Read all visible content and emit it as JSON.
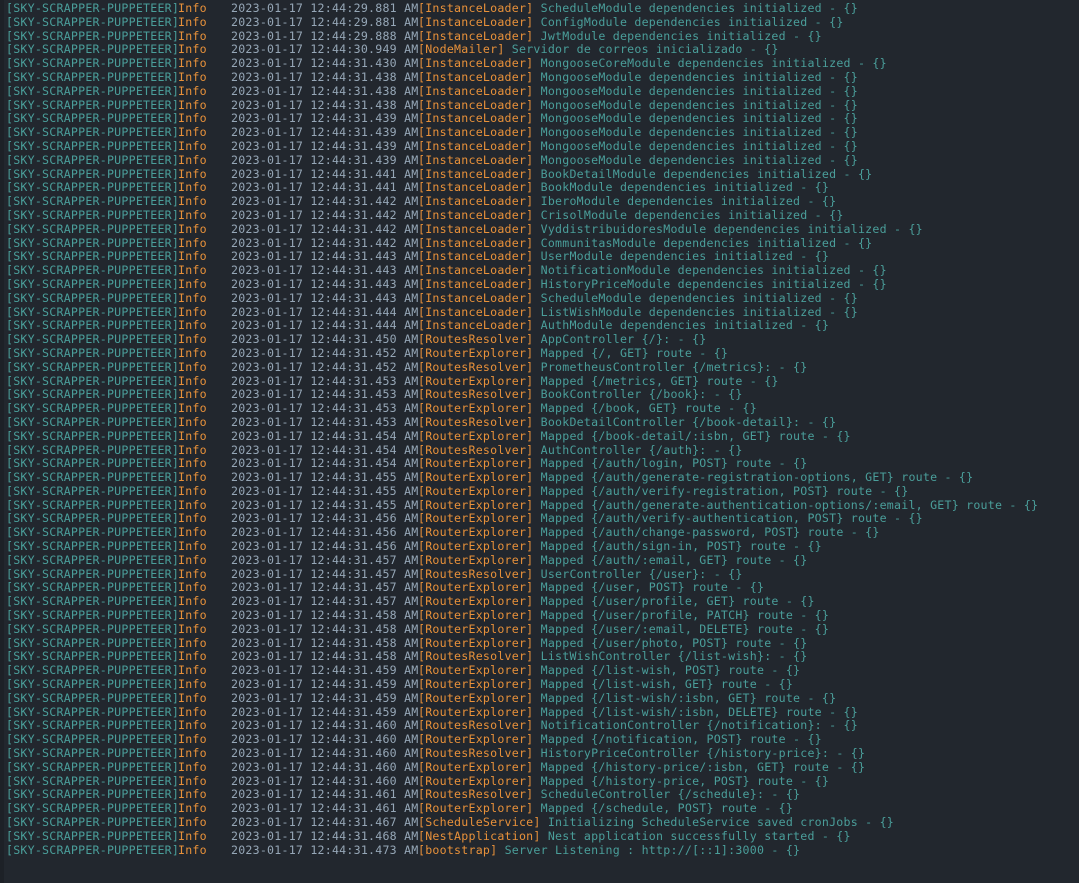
{
  "terminal": {
    "background_color": "#22272e",
    "prefix_color": "#4a9e9a",
    "level_color": "#e8913a",
    "timestamp_color": "#96a7b7",
    "context_color": "#e8913a",
    "message_color": "#4a9e9a",
    "app_prefix": "[SKY-SCRAPPER-PUPPETEER]",
    "level": "Info",
    "date": "2023-01-17",
    "meridiem": "AM",
    "line_count": 63
  },
  "lines": [
    {
      "prefix": "[SKY-SCRAPPER-PUPPETEER]",
      "level": "Info",
      "time": "2023-01-17 12:44:29.881 AM",
      "context": "[InstanceLoader]",
      "message": "ScheduleModule dependencies initialized - {}"
    },
    {
      "prefix": "[SKY-SCRAPPER-PUPPETEER]",
      "level": "Info",
      "time": "2023-01-17 12:44:29.881 AM",
      "context": "[InstanceLoader]",
      "message": "ConfigModule dependencies initialized - {}"
    },
    {
      "prefix": "[SKY-SCRAPPER-PUPPETEER]",
      "level": "Info",
      "time": "2023-01-17 12:44:29.888 AM",
      "context": "[InstanceLoader]",
      "message": "JwtModule dependencies initialized - {}"
    },
    {
      "prefix": "[SKY-SCRAPPER-PUPPETEER]",
      "level": "Info",
      "time": "2023-01-17 12:44:30.949 AM",
      "context": "[NodeMailer]",
      "message": "Servidor de correos inicializado - {}"
    },
    {
      "prefix": "[SKY-SCRAPPER-PUPPETEER]",
      "level": "Info",
      "time": "2023-01-17 12:44:31.430 AM",
      "context": "[InstanceLoader]",
      "message": "MongooseCoreModule dependencies initialized - {}"
    },
    {
      "prefix": "[SKY-SCRAPPER-PUPPETEER]",
      "level": "Info",
      "time": "2023-01-17 12:44:31.438 AM",
      "context": "[InstanceLoader]",
      "message": "MongooseModule dependencies initialized - {}"
    },
    {
      "prefix": "[SKY-SCRAPPER-PUPPETEER]",
      "level": "Info",
      "time": "2023-01-17 12:44:31.438 AM",
      "context": "[InstanceLoader]",
      "message": "MongooseModule dependencies initialized - {}"
    },
    {
      "prefix": "[SKY-SCRAPPER-PUPPETEER]",
      "level": "Info",
      "time": "2023-01-17 12:44:31.438 AM",
      "context": "[InstanceLoader]",
      "message": "MongooseModule dependencies initialized - {}"
    },
    {
      "prefix": "[SKY-SCRAPPER-PUPPETEER]",
      "level": "Info",
      "time": "2023-01-17 12:44:31.439 AM",
      "context": "[InstanceLoader]",
      "message": "MongooseModule dependencies initialized - {}"
    },
    {
      "prefix": "[SKY-SCRAPPER-PUPPETEER]",
      "level": "Info",
      "time": "2023-01-17 12:44:31.439 AM",
      "context": "[InstanceLoader]",
      "message": "MongooseModule dependencies initialized - {}"
    },
    {
      "prefix": "[SKY-SCRAPPER-PUPPETEER]",
      "level": "Info",
      "time": "2023-01-17 12:44:31.439 AM",
      "context": "[InstanceLoader]",
      "message": "MongooseModule dependencies initialized - {}"
    },
    {
      "prefix": "[SKY-SCRAPPER-PUPPETEER]",
      "level": "Info",
      "time": "2023-01-17 12:44:31.439 AM",
      "context": "[InstanceLoader]",
      "message": "MongooseModule dependencies initialized - {}"
    },
    {
      "prefix": "[SKY-SCRAPPER-PUPPETEER]",
      "level": "Info",
      "time": "2023-01-17 12:44:31.441 AM",
      "context": "[InstanceLoader]",
      "message": "BookDetailModule dependencies initialized - {}"
    },
    {
      "prefix": "[SKY-SCRAPPER-PUPPETEER]",
      "level": "Info",
      "time": "2023-01-17 12:44:31.441 AM",
      "context": "[InstanceLoader]",
      "message": "BookModule dependencies initialized - {}"
    },
    {
      "prefix": "[SKY-SCRAPPER-PUPPETEER]",
      "level": "Info",
      "time": "2023-01-17 12:44:31.442 AM",
      "context": "[InstanceLoader]",
      "message": "IberoModule dependencies initialized - {}"
    },
    {
      "prefix": "[SKY-SCRAPPER-PUPPETEER]",
      "level": "Info",
      "time": "2023-01-17 12:44:31.442 AM",
      "context": "[InstanceLoader]",
      "message": "CrisolModule dependencies initialized - {}"
    },
    {
      "prefix": "[SKY-SCRAPPER-PUPPETEER]",
      "level": "Info",
      "time": "2023-01-17 12:44:31.442 AM",
      "context": "[InstanceLoader]",
      "message": "VyddistribuidoresModule dependencies initialized - {}"
    },
    {
      "prefix": "[SKY-SCRAPPER-PUPPETEER]",
      "level": "Info",
      "time": "2023-01-17 12:44:31.442 AM",
      "context": "[InstanceLoader]",
      "message": "CommunitasModule dependencies initialized - {}"
    },
    {
      "prefix": "[SKY-SCRAPPER-PUPPETEER]",
      "level": "Info",
      "time": "2023-01-17 12:44:31.443 AM",
      "context": "[InstanceLoader]",
      "message": "UserModule dependencies initialized - {}"
    },
    {
      "prefix": "[SKY-SCRAPPER-PUPPETEER]",
      "level": "Info",
      "time": "2023-01-17 12:44:31.443 AM",
      "context": "[InstanceLoader]",
      "message": "NotificationModule dependencies initialized - {}"
    },
    {
      "prefix": "[SKY-SCRAPPER-PUPPETEER]",
      "level": "Info",
      "time": "2023-01-17 12:44:31.443 AM",
      "context": "[InstanceLoader]",
      "message": "HistoryPriceModule dependencies initialized - {}"
    },
    {
      "prefix": "[SKY-SCRAPPER-PUPPETEER]",
      "level": "Info",
      "time": "2023-01-17 12:44:31.443 AM",
      "context": "[InstanceLoader]",
      "message": "ScheduleModule dependencies initialized - {}"
    },
    {
      "prefix": "[SKY-SCRAPPER-PUPPETEER]",
      "level": "Info",
      "time": "2023-01-17 12:44:31.444 AM",
      "context": "[InstanceLoader]",
      "message": "ListWishModule dependencies initialized - {}"
    },
    {
      "prefix": "[SKY-SCRAPPER-PUPPETEER]",
      "level": "Info",
      "time": "2023-01-17 12:44:31.444 AM",
      "context": "[InstanceLoader]",
      "message": "AuthModule dependencies initialized - {}"
    },
    {
      "prefix": "[SKY-SCRAPPER-PUPPETEER]",
      "level": "Info",
      "time": "2023-01-17 12:44:31.450 AM",
      "context": "[RoutesResolver]",
      "message": "AppController {/}: - {}"
    },
    {
      "prefix": "[SKY-SCRAPPER-PUPPETEER]",
      "level": "Info",
      "time": "2023-01-17 12:44:31.452 AM",
      "context": "[RouterExplorer]",
      "message": "Mapped {/, GET} route - {}"
    },
    {
      "prefix": "[SKY-SCRAPPER-PUPPETEER]",
      "level": "Info",
      "time": "2023-01-17 12:44:31.452 AM",
      "context": "[RoutesResolver]",
      "message": "PrometheusController {/metrics}: - {}"
    },
    {
      "prefix": "[SKY-SCRAPPER-PUPPETEER]",
      "level": "Info",
      "time": "2023-01-17 12:44:31.453 AM",
      "context": "[RouterExplorer]",
      "message": "Mapped {/metrics, GET} route - {}"
    },
    {
      "prefix": "[SKY-SCRAPPER-PUPPETEER]",
      "level": "Info",
      "time": "2023-01-17 12:44:31.453 AM",
      "context": "[RoutesResolver]",
      "message": "BookController {/book}: - {}"
    },
    {
      "prefix": "[SKY-SCRAPPER-PUPPETEER]",
      "level": "Info",
      "time": "2023-01-17 12:44:31.453 AM",
      "context": "[RouterExplorer]",
      "message": "Mapped {/book, GET} route - {}"
    },
    {
      "prefix": "[SKY-SCRAPPER-PUPPETEER]",
      "level": "Info",
      "time": "2023-01-17 12:44:31.453 AM",
      "context": "[RoutesResolver]",
      "message": "BookDetailController {/book-detail}: - {}"
    },
    {
      "prefix": "[SKY-SCRAPPER-PUPPETEER]",
      "level": "Info",
      "time": "2023-01-17 12:44:31.454 AM",
      "context": "[RouterExplorer]",
      "message": "Mapped {/book-detail/:isbn, GET} route - {}"
    },
    {
      "prefix": "[SKY-SCRAPPER-PUPPETEER]",
      "level": "Info",
      "time": "2023-01-17 12:44:31.454 AM",
      "context": "[RoutesResolver]",
      "message": "AuthController {/auth}: - {}"
    },
    {
      "prefix": "[SKY-SCRAPPER-PUPPETEER]",
      "level": "Info",
      "time": "2023-01-17 12:44:31.454 AM",
      "context": "[RouterExplorer]",
      "message": "Mapped {/auth/login, POST} route - {}"
    },
    {
      "prefix": "[SKY-SCRAPPER-PUPPETEER]",
      "level": "Info",
      "time": "2023-01-17 12:44:31.455 AM",
      "context": "[RouterExplorer]",
      "message": "Mapped {/auth/generate-registration-options, GET} route - {}"
    },
    {
      "prefix": "[SKY-SCRAPPER-PUPPETEER]",
      "level": "Info",
      "time": "2023-01-17 12:44:31.455 AM",
      "context": "[RouterExplorer]",
      "message": "Mapped {/auth/verify-registration, POST} route - {}"
    },
    {
      "prefix": "[SKY-SCRAPPER-PUPPETEER]",
      "level": "Info",
      "time": "2023-01-17 12:44:31.455 AM",
      "context": "[RouterExplorer]",
      "message": "Mapped {/auth/generate-authentication-options/:email, GET} route - {}"
    },
    {
      "prefix": "[SKY-SCRAPPER-PUPPETEER]",
      "level": "Info",
      "time": "2023-01-17 12:44:31.456 AM",
      "context": "[RouterExplorer]",
      "message": "Mapped {/auth/verify-authentication, POST} route - {}"
    },
    {
      "prefix": "[SKY-SCRAPPER-PUPPETEER]",
      "level": "Info",
      "time": "2023-01-17 12:44:31.456 AM",
      "context": "[RouterExplorer]",
      "message": "Mapped {/auth/change-password, POST} route - {}"
    },
    {
      "prefix": "[SKY-SCRAPPER-PUPPETEER]",
      "level": "Info",
      "time": "2023-01-17 12:44:31.456 AM",
      "context": "[RouterExplorer]",
      "message": "Mapped {/auth/sign-in, POST} route - {}"
    },
    {
      "prefix": "[SKY-SCRAPPER-PUPPETEER]",
      "level": "Info",
      "time": "2023-01-17 12:44:31.457 AM",
      "context": "[RouterExplorer]",
      "message": "Mapped {/auth/:email, GET} route - {}"
    },
    {
      "prefix": "[SKY-SCRAPPER-PUPPETEER]",
      "level": "Info",
      "time": "2023-01-17 12:44:31.457 AM",
      "context": "[RoutesResolver]",
      "message": "UserController {/user}: - {}"
    },
    {
      "prefix": "[SKY-SCRAPPER-PUPPETEER]",
      "level": "Info",
      "time": "2023-01-17 12:44:31.457 AM",
      "context": "[RouterExplorer]",
      "message": "Mapped {/user, POST} route - {}"
    },
    {
      "prefix": "[SKY-SCRAPPER-PUPPETEER]",
      "level": "Info",
      "time": "2023-01-17 12:44:31.457 AM",
      "context": "[RouterExplorer]",
      "message": "Mapped {/user/profile, GET} route - {}"
    },
    {
      "prefix": "[SKY-SCRAPPER-PUPPETEER]",
      "level": "Info",
      "time": "2023-01-17 12:44:31.458 AM",
      "context": "[RouterExplorer]",
      "message": "Mapped {/user/profile, PATCH} route - {}"
    },
    {
      "prefix": "[SKY-SCRAPPER-PUPPETEER]",
      "level": "Info",
      "time": "2023-01-17 12:44:31.458 AM",
      "context": "[RouterExplorer]",
      "message": "Mapped {/user/:email, DELETE} route - {}"
    },
    {
      "prefix": "[SKY-SCRAPPER-PUPPETEER]",
      "level": "Info",
      "time": "2023-01-17 12:44:31.458 AM",
      "context": "[RouterExplorer]",
      "message": "Mapped {/user/photo, POST} route - {}"
    },
    {
      "prefix": "[SKY-SCRAPPER-PUPPETEER]",
      "level": "Info",
      "time": "2023-01-17 12:44:31.458 AM",
      "context": "[RoutesResolver]",
      "message": "ListWishController {/list-wish}: - {}"
    },
    {
      "prefix": "[SKY-SCRAPPER-PUPPETEER]",
      "level": "Info",
      "time": "2023-01-17 12:44:31.459 AM",
      "context": "[RouterExplorer]",
      "message": "Mapped {/list-wish, POST} route - {}"
    },
    {
      "prefix": "[SKY-SCRAPPER-PUPPETEER]",
      "level": "Info",
      "time": "2023-01-17 12:44:31.459 AM",
      "context": "[RouterExplorer]",
      "message": "Mapped {/list-wish, GET} route - {}"
    },
    {
      "prefix": "[SKY-SCRAPPER-PUPPETEER]",
      "level": "Info",
      "time": "2023-01-17 12:44:31.459 AM",
      "context": "[RouterExplorer]",
      "message": "Mapped {/list-wish/:isbn, GET} route - {}"
    },
    {
      "prefix": "[SKY-SCRAPPER-PUPPETEER]",
      "level": "Info",
      "time": "2023-01-17 12:44:31.459 AM",
      "context": "[RouterExplorer]",
      "message": "Mapped {/list-wish/:isbn, DELETE} route - {}"
    },
    {
      "prefix": "[SKY-SCRAPPER-PUPPETEER]",
      "level": "Info",
      "time": "2023-01-17 12:44:31.460 AM",
      "context": "[RoutesResolver]",
      "message": "NotificationController {/notification}: - {}"
    },
    {
      "prefix": "[SKY-SCRAPPER-PUPPETEER]",
      "level": "Info",
      "time": "2023-01-17 12:44:31.460 AM",
      "context": "[RouterExplorer]",
      "message": "Mapped {/notification, POST} route - {}"
    },
    {
      "prefix": "[SKY-SCRAPPER-PUPPETEER]",
      "level": "Info",
      "time": "2023-01-17 12:44:31.460 AM",
      "context": "[RoutesResolver]",
      "message": "HistoryPriceController {/history-price}: - {}"
    },
    {
      "prefix": "[SKY-SCRAPPER-PUPPETEER]",
      "level": "Info",
      "time": "2023-01-17 12:44:31.460 AM",
      "context": "[RouterExplorer]",
      "message": "Mapped {/history-price/:isbn, GET} route - {}"
    },
    {
      "prefix": "[SKY-SCRAPPER-PUPPETEER]",
      "level": "Info",
      "time": "2023-01-17 12:44:31.460 AM",
      "context": "[RouterExplorer]",
      "message": "Mapped {/history-price, POST} route - {}"
    },
    {
      "prefix": "[SKY-SCRAPPER-PUPPETEER]",
      "level": "Info",
      "time": "2023-01-17 12:44:31.461 AM",
      "context": "[RoutesResolver]",
      "message": "ScheduleController {/schedule}: - {}"
    },
    {
      "prefix": "[SKY-SCRAPPER-PUPPETEER]",
      "level": "Info",
      "time": "2023-01-17 12:44:31.461 AM",
      "context": "[RouterExplorer]",
      "message": "Mapped {/schedule, POST} route - {}"
    },
    {
      "prefix": "[SKY-SCRAPPER-PUPPETEER]",
      "level": "Info",
      "time": "2023-01-17 12:44:31.467 AM",
      "context": "[ScheduleService]",
      "message": "Initializing ScheduleService saved cronJobs - {}"
    },
    {
      "prefix": "[SKY-SCRAPPER-PUPPETEER]",
      "level": "Info",
      "time": "2023-01-17 12:44:31.468 AM",
      "context": "[NestApplication]",
      "message": "Nest application successfully started - {}"
    },
    {
      "prefix": "[SKY-SCRAPPER-PUPPETEER]",
      "level": "Info",
      "time": "2023-01-17 12:44:31.473 AM",
      "context": "[bootstrap]",
      "message": "Server Listening : http://[::1]:3000 - {}"
    }
  ]
}
